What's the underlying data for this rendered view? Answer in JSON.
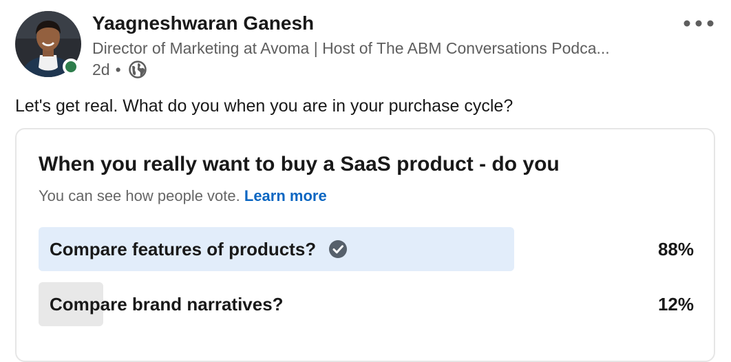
{
  "author": {
    "name": "Yaagneshwaran Ganesh",
    "headline": "Director of Marketing at Avoma | Host of The ABM Conversations Podca...",
    "posted_ago": "2d",
    "separator": "•",
    "visibility_icon": "globe-icon",
    "presence_color": "#2e7d4c"
  },
  "post": {
    "text": "Let's get real. What do you when you are in your purchase cycle?"
  },
  "poll": {
    "question": "When you really want to buy a SaaS product - do you",
    "visibility_note": "You can see how people vote.",
    "learn_more": "Learn more",
    "options": [
      {
        "label": "Compare features of products?",
        "percent_label": "88%",
        "fraction": 0.88,
        "selected": true,
        "bar_color": "#e2edfa",
        "check_icon": "check-circle-icon"
      },
      {
        "label": "Compare brand narratives?",
        "percent_label": "12%",
        "fraction": 0.12,
        "selected": false,
        "bar_color": "#e8e8e8"
      }
    ]
  },
  "colors": {
    "link": "#0a66c2",
    "text_primary": "#191919",
    "text_secondary": "#5e5e5e"
  }
}
